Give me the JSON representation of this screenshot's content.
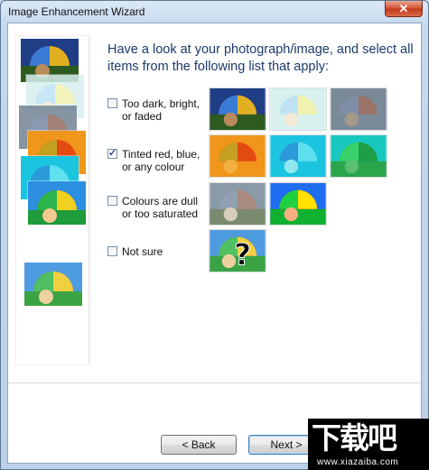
{
  "window": {
    "title": "Image Enhancement Wizard",
    "close_glyph": "✕"
  },
  "heading": "Have a look at your photograph/image, and select all items from the following list that apply:",
  "options": [
    {
      "label": "Too dark, bright,\nor faded",
      "checked": false
    },
    {
      "label": "Tinted red, blue,\nor any colour",
      "checked": true
    },
    {
      "label": "Colours are dull\nor too saturated",
      "checked": false
    },
    {
      "label": "Not sure",
      "checked": false
    }
  ],
  "buttons": {
    "back": "< Back",
    "next": "Next >"
  },
  "watermark": {
    "chars": "下载吧",
    "url": "www.xiazaiba.com"
  },
  "icons": {
    "close": "close-icon",
    "umbrella": "umbrella-thumbnail-icon",
    "question": "question-mark-icon"
  }
}
